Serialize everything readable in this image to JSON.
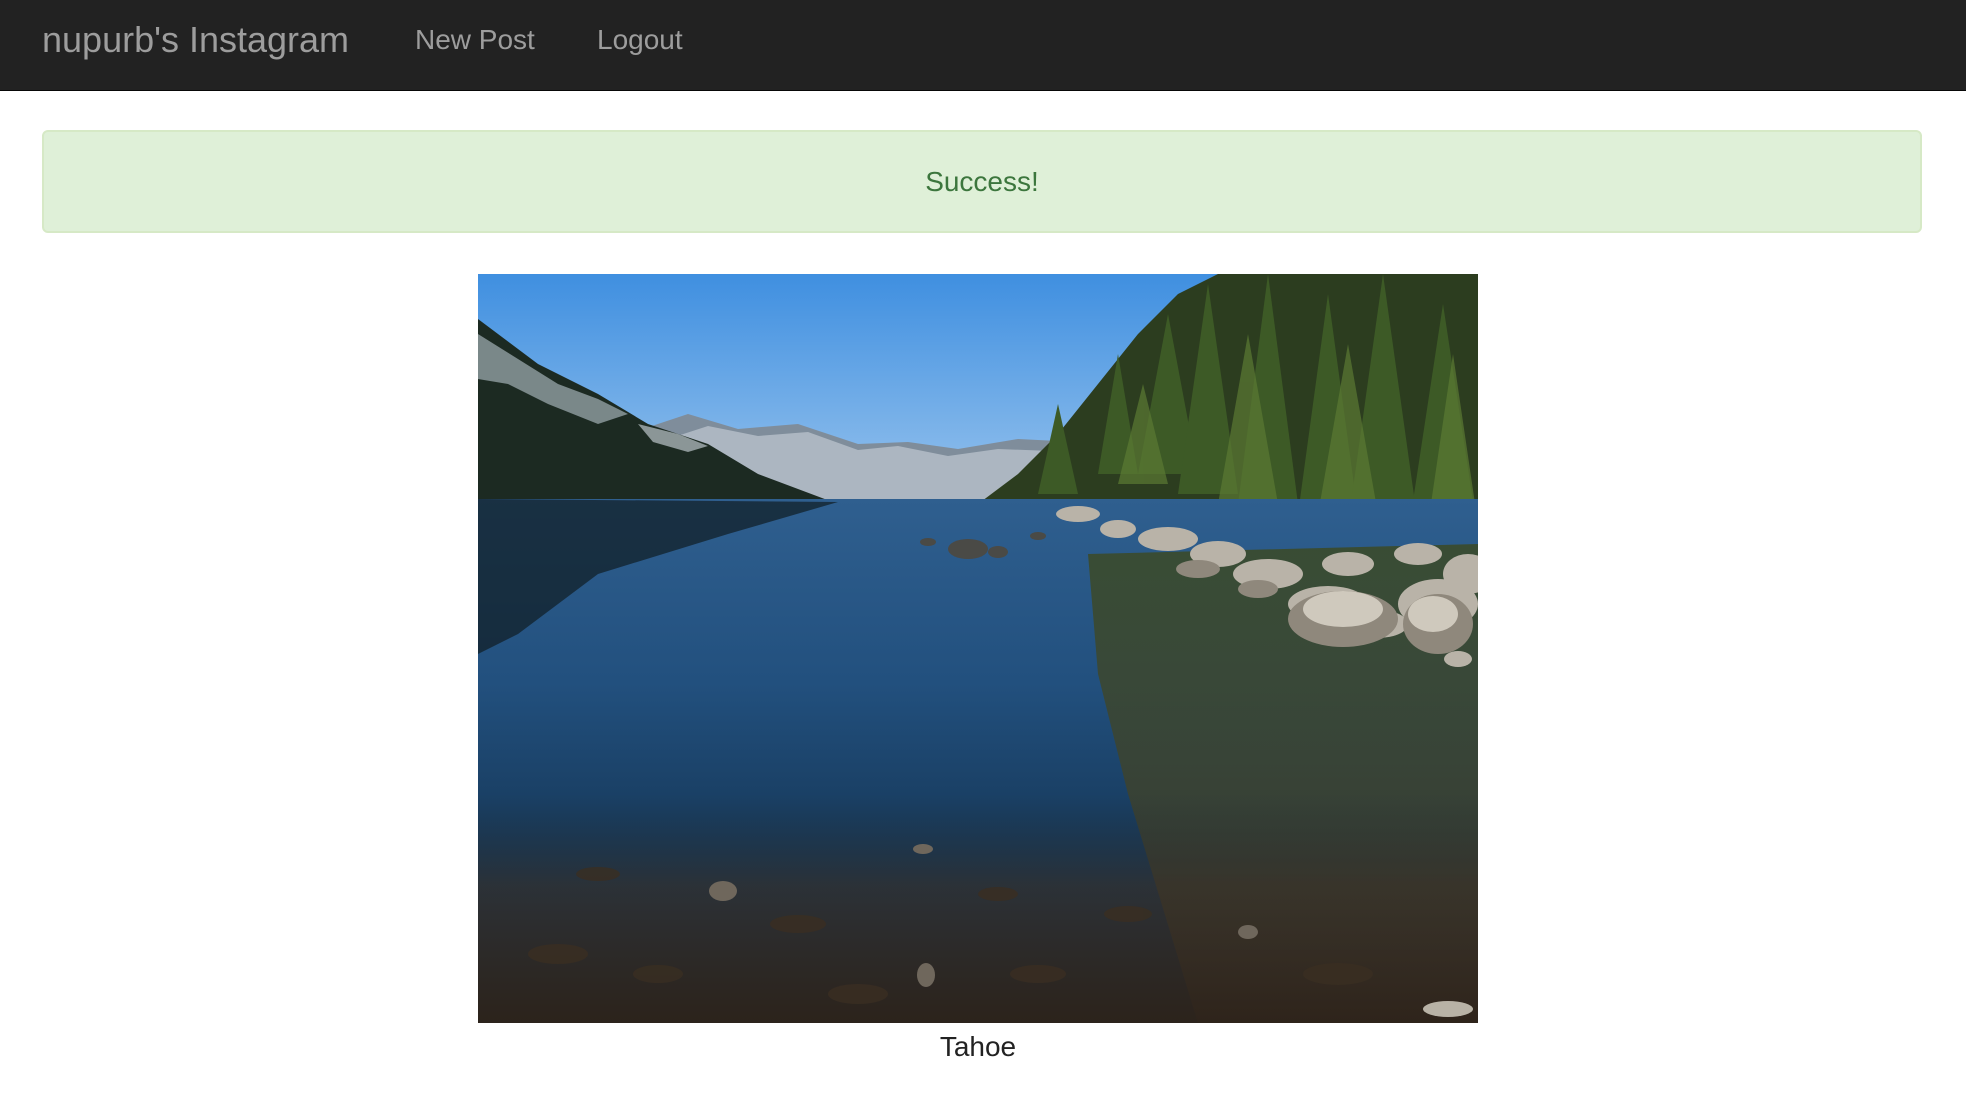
{
  "navbar": {
    "brand": "nupurb's Instagram",
    "links": [
      {
        "label": "New Post"
      },
      {
        "label": "Logout"
      }
    ],
    "background": "#222222",
    "text_color": "#9d9d9d"
  },
  "alert": {
    "message": "Success!",
    "background": "#dff0d8",
    "text_color": "#3c763d"
  },
  "post": {
    "image_subject": "mountain lake with pine trees and rocky shore",
    "caption": "Tahoe"
  }
}
